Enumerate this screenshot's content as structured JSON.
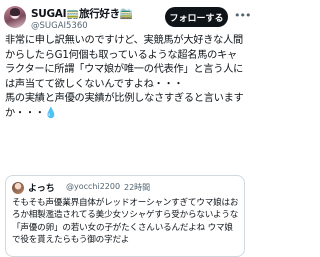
{
  "header": {
    "display_name": "SUGAI🚃旅行好き🚞",
    "handle": "@SUGAI5360",
    "follow_label": "フォローする",
    "more_icon": "more-horizontal-icon"
  },
  "tweet": {
    "text": "非常に申し訳無いのですけど、実競馬が大好きな人間からしたらG1何個も取っているような超名馬のキャラクターに所謂「ウマ娘が唯一の代表作」と言う人には声当てて欲しくないんですよね・・・\n馬の実績と声優の実績が比例しなさすぎると言いますか・・・💧"
  },
  "quoted_tweet": {
    "display_name": "よっち",
    "handle": "@yocchi2200",
    "separator": "·",
    "time": "22時間",
    "text": "そもそも声優業界自体がレッドオーシャンすぎてウマ娘はおろか相製濫造されてる美少女ソシャゲすら受からないような「声優の卵」の若い女の子がたくさんいるんだよね ウマ娘で役を貰えたらもう御の字だよ"
  }
}
